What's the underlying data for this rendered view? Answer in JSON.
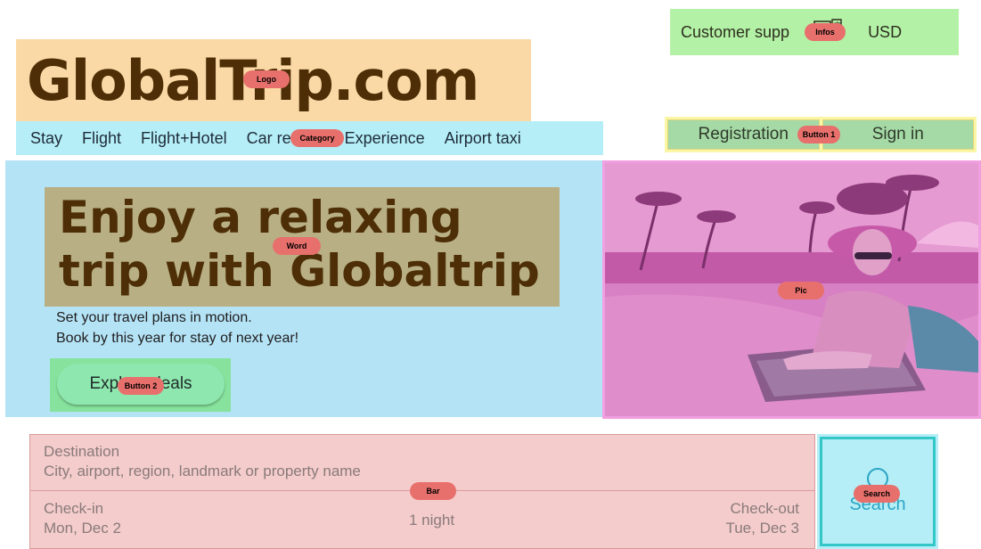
{
  "infos": {
    "support": "Customer supp",
    "currency": "USD",
    "icon": "translate-icon"
  },
  "logo": {
    "text": "GlobalTrip.com"
  },
  "nav": {
    "items": [
      "Stay",
      "Flight",
      "Flight+Hotel",
      "Car rentals",
      "Experience",
      "Airport taxi"
    ]
  },
  "auth": {
    "registration": "Registration",
    "signin": "Sign in"
  },
  "hero": {
    "headline_line1": "Enjoy a relaxing",
    "headline_line2": "trip with Globaltrip",
    "sub_line1": "Set your travel plans in motion.",
    "sub_line2": "Book by this year for stay of next year!",
    "explore": "Explore deals"
  },
  "search": {
    "destination_label": "Destination",
    "destination_placeholder": "City, airport, region, landmark or property name",
    "checkin_label": "Check-in",
    "checkin_value": "Mon, Dec 2",
    "nights": "1 night",
    "checkout_label": "Check-out",
    "checkout_value": "Tue, Dec 3",
    "button": "Search"
  },
  "tags": {
    "infos": "Infos",
    "logo": "Logo",
    "category": "Category",
    "button1": "Button 1",
    "word": "Word",
    "button2": "Button 2",
    "pic": "Pic",
    "bar": "Bar",
    "search": "Search"
  }
}
